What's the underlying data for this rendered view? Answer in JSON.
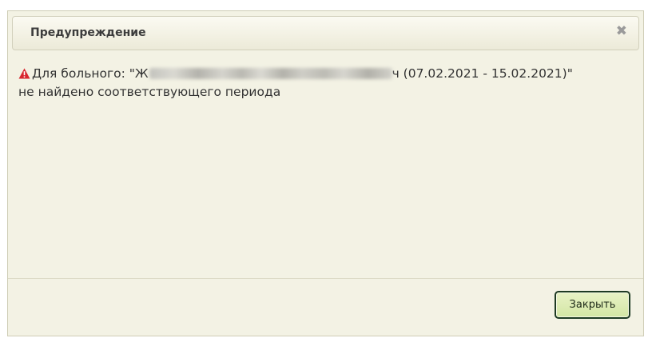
{
  "dialog": {
    "title": "Предупреждение",
    "close_icon": "close-icon",
    "message": {
      "prefix": "Для больного: \"Ж",
      "suffix": "ч (07.02.2021 - 15.02.2021)\"",
      "line2": "не найдено соответствующего периода",
      "icon": "warning-icon",
      "icon_color": "#d8262e"
    },
    "close_button_label": "Закрыть"
  }
}
